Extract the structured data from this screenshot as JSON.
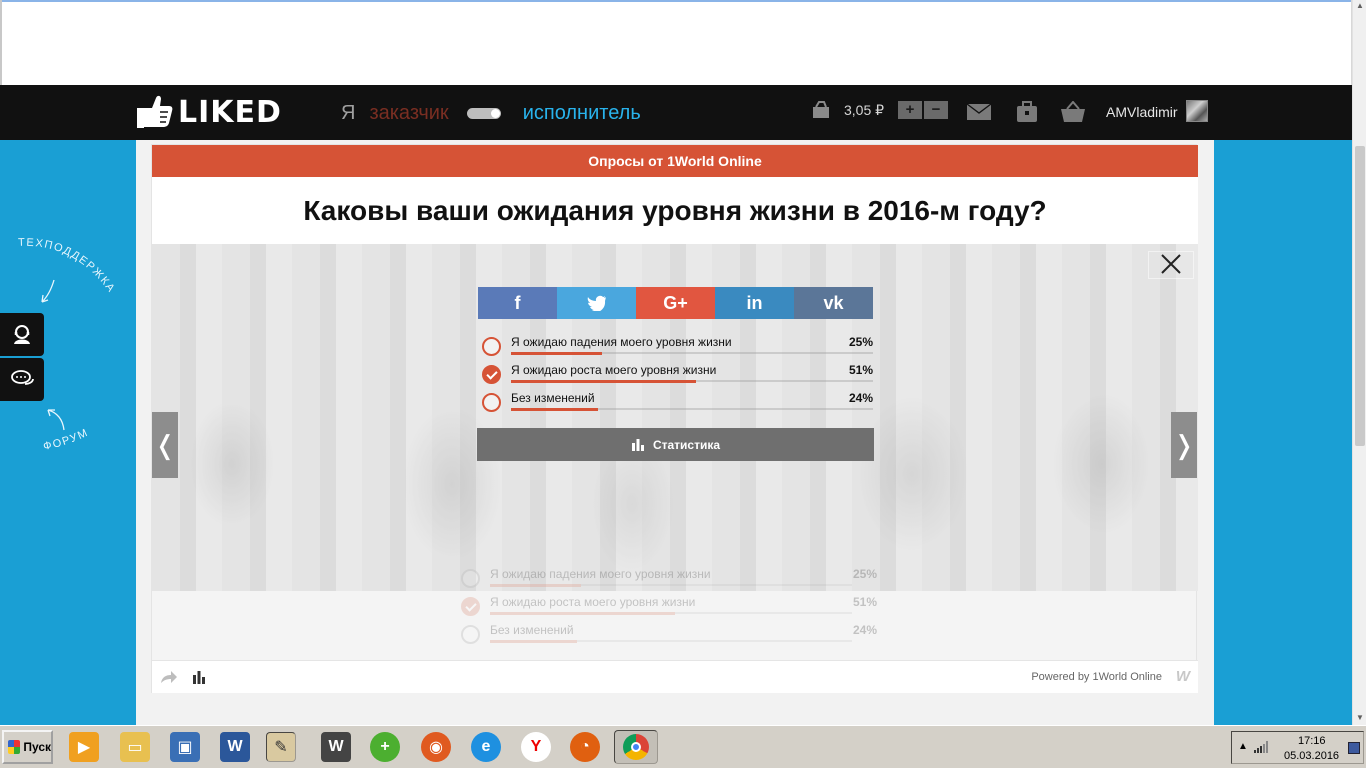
{
  "header": {
    "logo_text": "LIKED",
    "role_ya": "Я",
    "role_customer": "заказчик",
    "role_executor": "исполнитель",
    "balance": "3,05 ₽",
    "plus": "+",
    "minus": "−",
    "username": "AMVladimir"
  },
  "sidebar": {
    "support_label": "ТЕХПОДДЕРЖКА",
    "forum_label": "ФОРУМ"
  },
  "poll": {
    "source": "Опросы от 1World Online",
    "question": "Каковы ваши ожидания уровня жизни в 2016-м году?",
    "share": [
      "f",
      "",
      "G+",
      "in",
      "vk"
    ],
    "options": [
      {
        "label": "Я ожидаю падения моего уровня жизни",
        "percent": "25%",
        "value": 25,
        "checked": false
      },
      {
        "label": "Я ожидаю роста моего уровня жизни",
        "percent": "51%",
        "value": 51,
        "checked": true
      },
      {
        "label": "Без изменений",
        "percent": "24%",
        "value": 24,
        "checked": false
      }
    ],
    "stats_label": "Статистика",
    "nav_prev": "❬",
    "nav_next": "❭",
    "powered": "Powered by 1World Online",
    "powered_logo": "W"
  },
  "taskbar": {
    "start_label": "Пуск",
    "time": "17:16",
    "date": "05.03.2016"
  },
  "colors": {
    "accent": "#d65336",
    "header_bg": "#111111",
    "page_bg": "#1a9fd4",
    "executor": "#29b3ec"
  }
}
